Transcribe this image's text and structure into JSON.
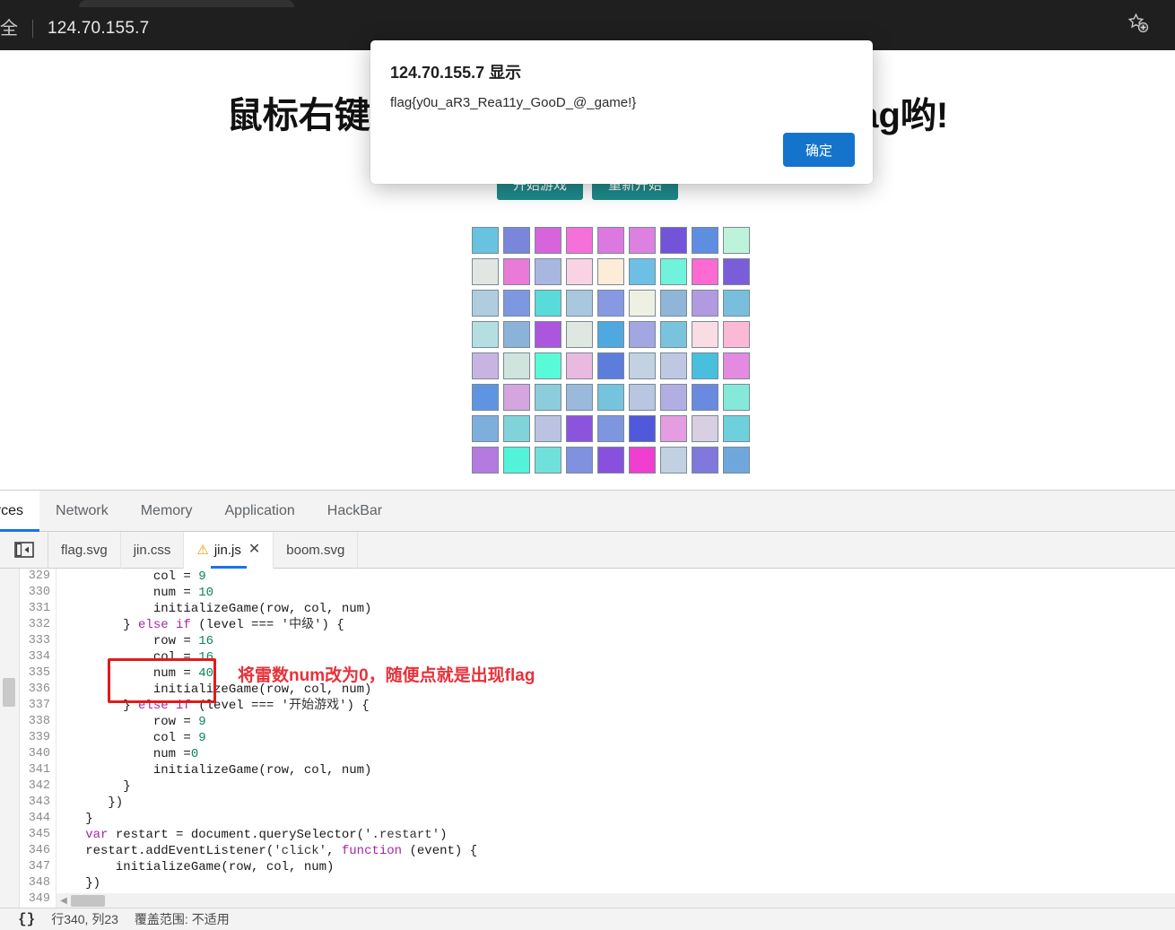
{
  "browser": {
    "security_label": "全",
    "url": "124.70.155.7",
    "bookmark_icon": "star-plus-icon"
  },
  "page": {
    "heading": "鼠标右键标记雷，全部标记完就会给你flag哟!",
    "buttons": [
      {
        "label": "开始游戏"
      },
      {
        "label": "重新开始"
      }
    ],
    "grid": {
      "rows": 8,
      "cols": 9,
      "colors": [
        [
          "#67c3e0",
          "#7a86da",
          "#d764dc",
          "#f571d9",
          "#dd78e0",
          "#dd81e0",
          "#7354d9",
          "#5d8ee0",
          "#bdf3da"
        ],
        [
          "#e2e6e2",
          "#ea7ad7",
          "#a8b7df",
          "#f9d3e4",
          "#fcecd8",
          "#6dc0e4",
          "#71f2da",
          "#fc6ad2",
          "#7a5ed9"
        ],
        [
          "#b0cde0",
          "#7d97e0",
          "#58dbd9",
          "#a9c7dd",
          "#8799e3",
          "#eef0e2",
          "#8fb5d9",
          "#b19ae0",
          "#79bedd"
        ],
        [
          "#b5dee2",
          "#8bb2d9",
          "#ab56dd",
          "#dee7e0",
          "#4fa9e0",
          "#a2a6e1",
          "#79c4dc",
          "#f9dce4",
          "#fcb9d6"
        ],
        [
          "#c8b4e2",
          "#cfe4dd",
          "#59fad8",
          "#e9b9e0",
          "#5d7ddd",
          "#c3d2e2",
          "#bfc8e3",
          "#49bfde",
          "#e48ae0"
        ],
        [
          "#5f95e0",
          "#d4a5df",
          "#8cccdb",
          "#9ab9dc",
          "#76c3dd",
          "#b8c6e2",
          "#b3aee2",
          "#6a8ae0",
          "#85e9da"
        ],
        [
          "#7eaedc",
          "#81d3da",
          "#bcc2e2",
          "#8c54dd",
          "#7e95e0",
          "#5059dc",
          "#e59ce0",
          "#d9cfe2",
          "#6ed0dc"
        ],
        [
          "#b57adf",
          "#52f3d8",
          "#6fe1da",
          "#8091e0",
          "#8751dd",
          "#f03fd0",
          "#c2d1e2",
          "#8078db",
          "#6fa7dc"
        ]
      ]
    }
  },
  "dialog": {
    "title": "124.70.155.7 显示",
    "message": "flag{y0u_aR3_Rea11y_GooD_@_game!}",
    "ok_label": "确定",
    "accent_color": "#1474cc"
  },
  "devtools": {
    "tabs": [
      {
        "label": "ources",
        "active": true
      },
      {
        "label": "Network",
        "active": false
      },
      {
        "label": "Memory",
        "active": false
      },
      {
        "label": "Application",
        "active": false
      },
      {
        "label": "HackBar",
        "active": false
      }
    ],
    "panel_toggle_icon": "sidebar-toggle-icon",
    "file_tabs": [
      {
        "label": "flag.svg",
        "active": false,
        "warning": false,
        "closable": false
      },
      {
        "label": "jin.css",
        "active": false,
        "warning": false,
        "closable": false
      },
      {
        "label": "jin.js",
        "active": true,
        "warning": true,
        "closable": true
      },
      {
        "label": "boom.svg",
        "active": false,
        "warning": false,
        "closable": false
      }
    ],
    "close_glyph": "✕",
    "warning_glyph": "⚠",
    "code": {
      "first_line_number": 329,
      "lines": [
        {
          "n": 329,
          "tokens": [
            {
              "t": "            col = ",
              "c": "plain"
            },
            {
              "t": "9",
              "c": "num"
            }
          ]
        },
        {
          "n": 330,
          "tokens": [
            {
              "t": "            num = ",
              "c": "plain"
            },
            {
              "t": "10",
              "c": "num"
            }
          ]
        },
        {
          "n": 331,
          "tokens": [
            {
              "t": "            initializeGame(row, col, num)",
              "c": "plain"
            }
          ]
        },
        {
          "n": 332,
          "tokens": [
            {
              "t": "        } ",
              "c": "plain"
            },
            {
              "t": "else",
              "c": "kw"
            },
            {
              "t": " ",
              "c": "plain"
            },
            {
              "t": "if",
              "c": "kw"
            },
            {
              "t": " (level === ",
              "c": "plain"
            },
            {
              "t": "'中级'",
              "c": "str"
            },
            {
              "t": ") {",
              "c": "plain"
            }
          ]
        },
        {
          "n": 333,
          "tokens": [
            {
              "t": "            row = ",
              "c": "plain"
            },
            {
              "t": "16",
              "c": "num"
            }
          ]
        },
        {
          "n": 334,
          "tokens": [
            {
              "t": "            col = ",
              "c": "plain"
            },
            {
              "t": "16",
              "c": "num"
            }
          ]
        },
        {
          "n": 335,
          "tokens": [
            {
              "t": "            num = ",
              "c": "plain"
            },
            {
              "t": "40",
              "c": "num"
            }
          ]
        },
        {
          "n": 336,
          "tokens": [
            {
              "t": "            initializeGame(row, col, num)",
              "c": "plain"
            }
          ]
        },
        {
          "n": 337,
          "tokens": [
            {
              "t": "        } ",
              "c": "plain"
            },
            {
              "t": "else",
              "c": "kw"
            },
            {
              "t": " ",
              "c": "plain"
            },
            {
              "t": "if",
              "c": "kw"
            },
            {
              "t": " (level === ",
              "c": "plain"
            },
            {
              "t": "'开始游戏'",
              "c": "str"
            },
            {
              "t": ") {",
              "c": "plain"
            }
          ]
        },
        {
          "n": 338,
          "tokens": [
            {
              "t": "            row = ",
              "c": "plain"
            },
            {
              "t": "9",
              "c": "num"
            }
          ]
        },
        {
          "n": 339,
          "tokens": [
            {
              "t": "            col = ",
              "c": "plain"
            },
            {
              "t": "9",
              "c": "num"
            }
          ]
        },
        {
          "n": 340,
          "tokens": [
            {
              "t": "            num =",
              "c": "plain"
            },
            {
              "t": "0",
              "c": "num"
            }
          ]
        },
        {
          "n": 341,
          "tokens": [
            {
              "t": "            initializeGame(row, col, num)",
              "c": "plain"
            }
          ]
        },
        {
          "n": 342,
          "tokens": [
            {
              "t": "        }",
              "c": "plain"
            }
          ]
        },
        {
          "n": 343,
          "tokens": [
            {
              "t": "      })",
              "c": "plain"
            }
          ]
        },
        {
          "n": 344,
          "tokens": [
            {
              "t": "   }",
              "c": "plain"
            }
          ]
        },
        {
          "n": 345,
          "tokens": [
            {
              "t": "   ",
              "c": "plain"
            },
            {
              "t": "var",
              "c": "kw"
            },
            {
              "t": " restart = document.querySelector(",
              "c": "plain"
            },
            {
              "t": "'.restart'",
              "c": "str"
            },
            {
              "t": ")",
              "c": "plain"
            }
          ]
        },
        {
          "n": 346,
          "tokens": [
            {
              "t": "   restart.addEventListener(",
              "c": "plain"
            },
            {
              "t": "'click'",
              "c": "str"
            },
            {
              "t": ", ",
              "c": "plain"
            },
            {
              "t": "function",
              "c": "kw"
            },
            {
              "t": " (event) {",
              "c": "plain"
            }
          ]
        },
        {
          "n": 347,
          "tokens": [
            {
              "t": "       initializeGame(row, col, num)",
              "c": "plain"
            }
          ]
        },
        {
          "n": 348,
          "tokens": [
            {
              "t": "   })",
              "c": "plain"
            }
          ]
        },
        {
          "n": 349,
          "tokens": [
            {
              "t": " `",
              "c": "plain"
            }
          ]
        }
      ],
      "annotation": "将雷数num改为0，随便点就是出现flag",
      "annotation_color": "#e8313a",
      "highlight_box_color": "#e01b1b"
    },
    "statusbar": {
      "format_icon": "{}",
      "position": "行340, 列23",
      "coverage": "覆盖范围: 不适用"
    }
  }
}
